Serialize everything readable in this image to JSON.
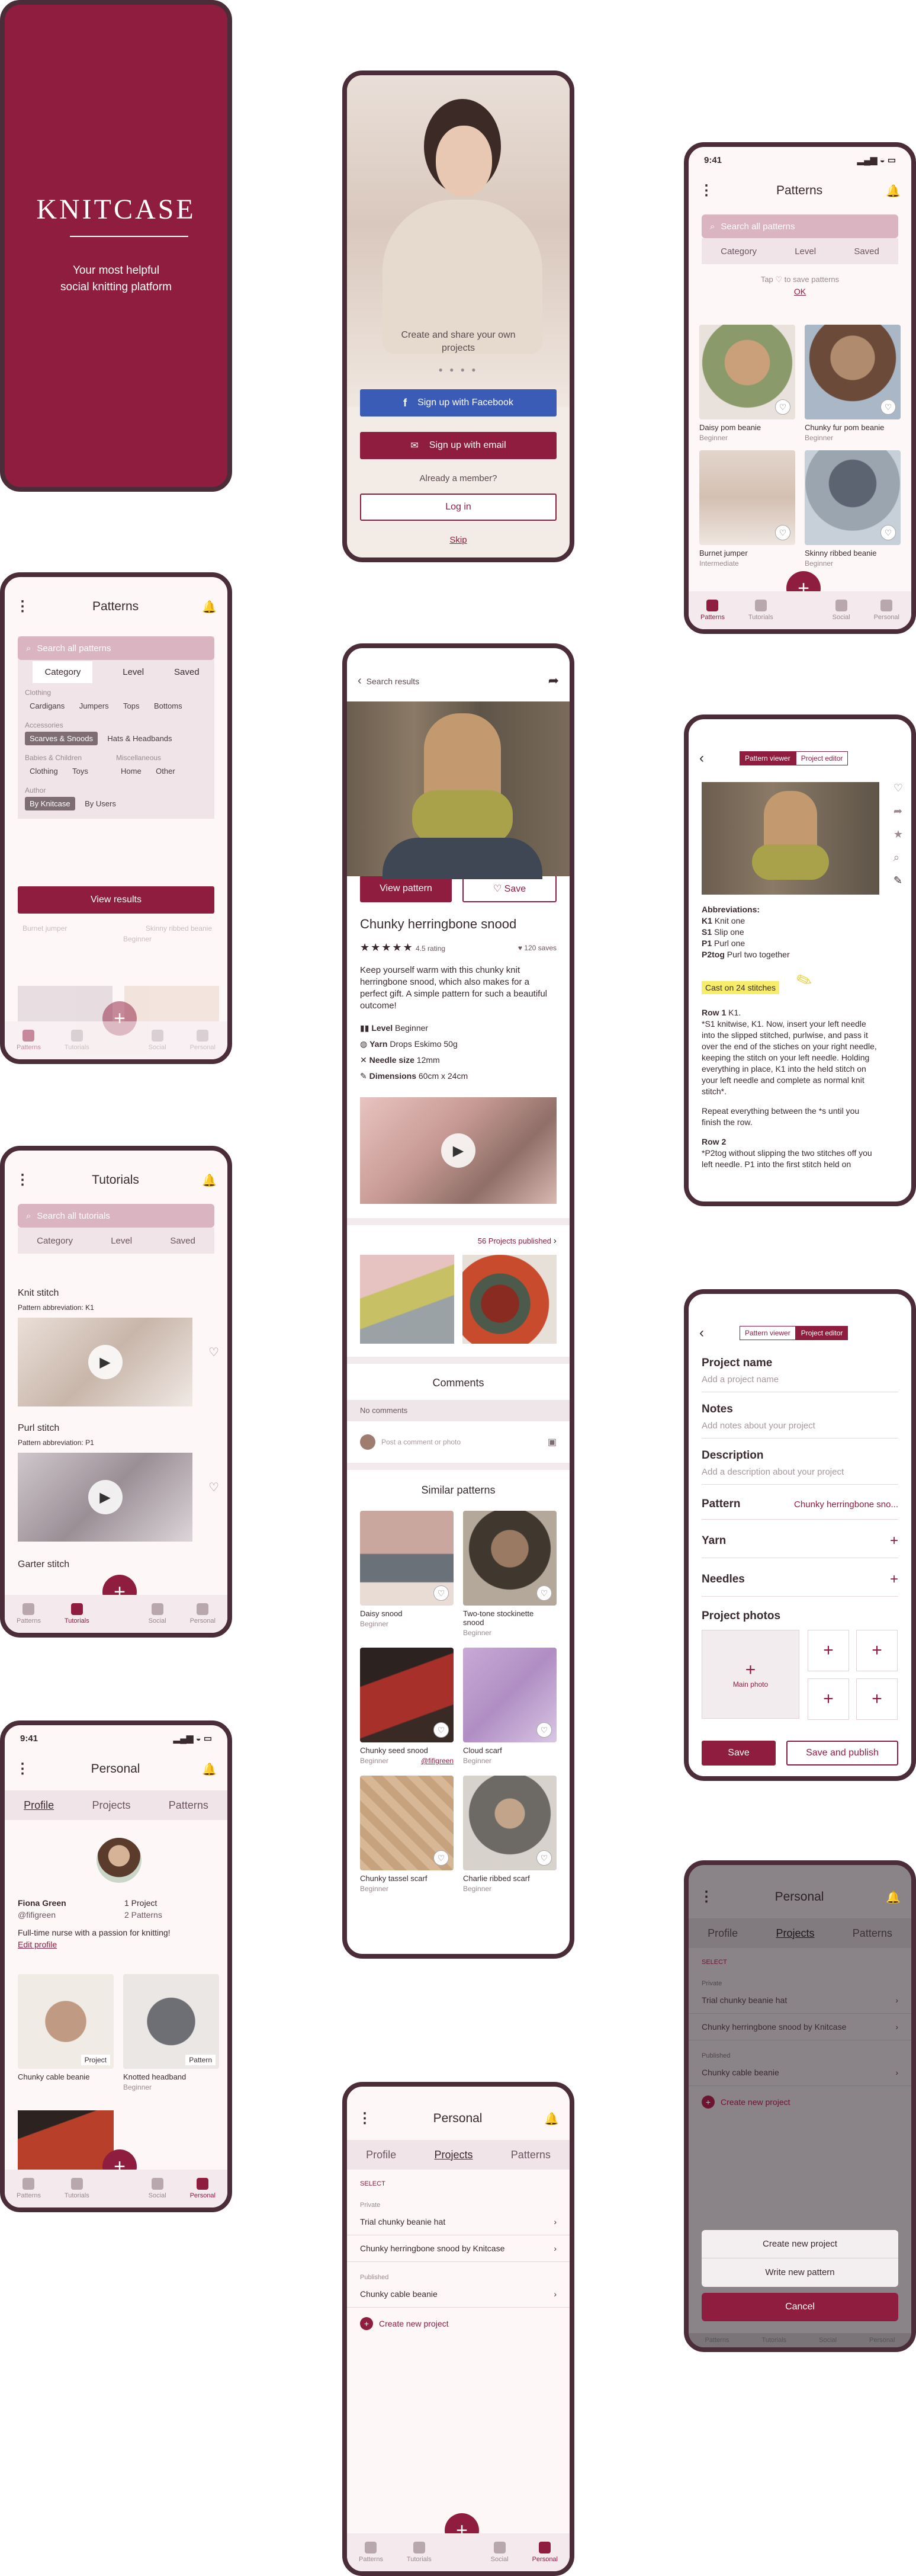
{
  "colors": {
    "brand": "#8f1d3f",
    "frame": "#4a2d38",
    "facebook": "#3b5cb6"
  },
  "splash": {
    "logo": "KNITCASE",
    "tagline1": "Your most helpful",
    "tagline2": "social knitting platform"
  },
  "welcome": {
    "headline1": "Create and share your own",
    "headline2": "projects",
    "facebook_btn": "Sign up with Facebook",
    "email_btn": "Sign up with email",
    "already": "Already a member?",
    "login_btn": "Log in",
    "skip": "Skip"
  },
  "patterns_screen": {
    "time": "9:41",
    "title": "Patterns",
    "search_placeholder": "Search all patterns",
    "filters": [
      "Category",
      "Level",
      "Saved"
    ],
    "hint": "Tap ♡ to save patterns",
    "ok": "OK",
    "items": [
      {
        "name": "Daisy pom beanie",
        "level": "Beginner"
      },
      {
        "name": "Chunky fur pom beanie",
        "level": "Beginner"
      },
      {
        "name": "Burnet jumper",
        "level": "Intermediate"
      },
      {
        "name": "Skinny ribbed beanie",
        "level": "Beginner"
      }
    ]
  },
  "tabbar": [
    "Patterns",
    "Tutorials",
    "Social",
    "Personal"
  ],
  "category_filter": {
    "title": "Patterns",
    "search_placeholder": "Search all patterns",
    "tabs": [
      "Category",
      "Level",
      "Saved"
    ],
    "groups": [
      {
        "heading": "Clothing",
        "chips": [
          "Cardigans",
          "Jumpers",
          "Tops",
          "Bottoms"
        ]
      },
      {
        "heading": "Accessories",
        "chips": [
          "Scarves & Snoods",
          "Hats & Headbands"
        ]
      },
      {
        "heading": "Babies & Children",
        "chips": [
          "Clothing",
          "Toys"
        ]
      },
      {
        "heading": "Miscellaneous",
        "chips": [
          "Home",
          "Other"
        ]
      },
      {
        "heading": "Author",
        "chips": [
          "By Knitcase",
          "By Users"
        ]
      }
    ],
    "view_results": "View results",
    "behind": [
      "Burnet jumper",
      "Skinny ribbed beanie",
      "Beginner"
    ]
  },
  "detail": {
    "back": "Search results",
    "view_btn": "View pattern",
    "save_btn": "♡ Save",
    "title": "Chunky herringbone snood",
    "rating": "4.5 rating",
    "saves": "120 saves",
    "desc": "Keep yourself warm with this chunky knit herringbone snood, which also makes for a perfect gift. A simple pattern for such a beautiful outcome!",
    "specs": [
      {
        "k": "Level",
        "v": "Beginner"
      },
      {
        "k": "Yarn",
        "v": "Drops Eskimo 50g"
      },
      {
        "k": "Needle size",
        "v": "12mm"
      },
      {
        "k": "Dimensions",
        "v": "60cm x 24cm"
      }
    ],
    "projects_published": "56 Projects published",
    "comments_title": "Comments",
    "no_comments": "No comments",
    "comment_placeholder": "Post a comment or photo",
    "similar_title": "Similar patterns",
    "similar": [
      {
        "name": "Daisy snood",
        "level": "Beginner"
      },
      {
        "name": "Two-tone stockinette snood",
        "level": "Beginner"
      },
      {
        "name": "Chunky seed snood",
        "level": "Beginner",
        "author": "@fifigreen"
      },
      {
        "name": "Cloud scarf",
        "level": "Beginner"
      },
      {
        "name": "Chunky tassel scarf",
        "level": "Beginner"
      },
      {
        "name": "Charlie ribbed scarf",
        "level": "Beginner"
      }
    ]
  },
  "viewer": {
    "tab_viewer": "Pattern viewer",
    "tab_editor": "Project editor",
    "abbrev_title": "Abbreviations:",
    "abbrevs": [
      {
        "k": "K1",
        "v": "Knit one"
      },
      {
        "k": "S1",
        "v": "Slip one"
      },
      {
        "k": "P1",
        "v": "Purl one"
      },
      {
        "k": "P2tog",
        "v": "Purl two together"
      }
    ],
    "cast_on": "Cast on 24 stitches",
    "row1_title": "Row 1",
    "row1_k": "K1.",
    "row1_body": "*S1 knitwise, K1. Now, insert your left needle into the slipped stitched, purlwise, and pass it over the end of the stiches on your right needle, keeping the stitch on your left needle. Holding everything in place, K1 into the held stitch on your left needle and complete as normal knit stitch*.",
    "repeat": "Repeat everything between the *s until you finish the row.",
    "row2_title": "Row 2",
    "row2_body": "*P2tog without slipping the two stitches off you left needle. P1 into the first stitch held on"
  },
  "tutorials": {
    "title": "Tutorials",
    "search_placeholder": "Search all tutorials",
    "filters": [
      "Category",
      "Level",
      "Saved"
    ],
    "items": [
      {
        "name": "Knit stitch",
        "abbr": "Pattern abbreviation: K1"
      },
      {
        "name": "Purl stitch",
        "abbr": "Pattern abbreviation: P1"
      },
      {
        "name": "Garter stitch",
        "abbr": ""
      }
    ]
  },
  "editor": {
    "tab_viewer": "Pattern viewer",
    "tab_editor": "Project editor",
    "fields": [
      {
        "label": "Project name",
        "ph": "Add a project name"
      },
      {
        "label": "Notes",
        "ph": "Add notes about your project"
      },
      {
        "label": "Description",
        "ph": "Add a description about your project"
      }
    ],
    "pattern_label": "Pattern",
    "pattern_value": "Chunky herringbone sno...",
    "yarn_label": "Yarn",
    "needles_label": "Needles",
    "photos_label": "Project photos",
    "main_photo": "Main photo",
    "save_btn": "Save",
    "publish_btn": "Save and publish"
  },
  "personal": {
    "time": "9:41",
    "title": "Personal",
    "tabs": [
      "Profile",
      "Projects",
      "Patterns"
    ],
    "name": "Fiona Green",
    "handle": "@fifigreen",
    "projects": "1 Project",
    "patterns": "2 Patterns",
    "bio": "Full-time nurse with a passion for knitting!",
    "edit": "Edit profile",
    "cards": [
      {
        "name": "Chunky cable beanie",
        "badge": "Project",
        "level": ""
      },
      {
        "name": "Knotted headband",
        "badge": "Pattern",
        "level": "Beginner"
      }
    ]
  },
  "projects": {
    "title": "Personal",
    "tabs": [
      "Profile",
      "Projects",
      "Patterns"
    ],
    "select": "SELECT",
    "private": "Private",
    "private_items": [
      "Trial chunky beanie hat",
      "Chunky herringbone snood by Knitcase"
    ],
    "published": "Published",
    "published_items": [
      "Chunky cable beanie"
    ],
    "create": "Create new project"
  },
  "sheet": {
    "title": "Personal",
    "tabs": [
      "Profile",
      "Projects",
      "Patterns"
    ],
    "select": "SELECT",
    "private": "Private",
    "private_items": [
      "Trial chunky beanie hat",
      "Chunky herringbone snood by Knitcase"
    ],
    "published": "Published",
    "published_items": [
      "Chunky cable beanie"
    ],
    "create": "Create new project",
    "actions": [
      "Create new project",
      "Write new pattern"
    ],
    "cancel": "Cancel"
  }
}
